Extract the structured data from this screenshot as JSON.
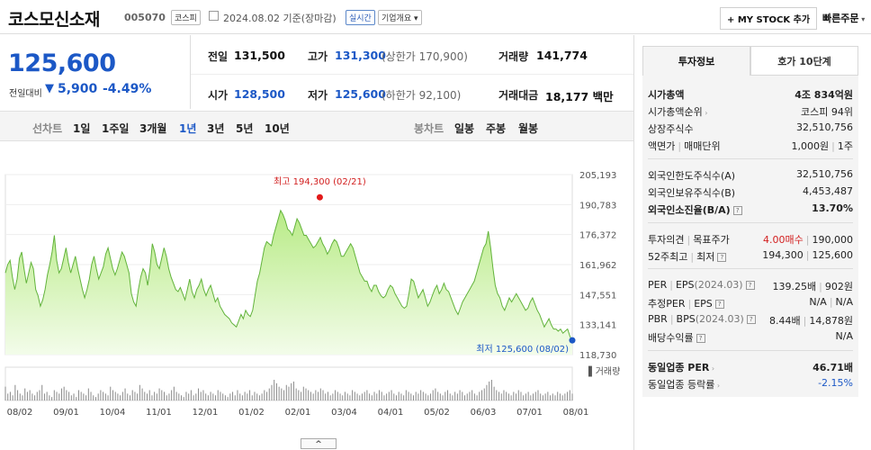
{
  "header": {
    "name": "코스모신소재",
    "code": "005070",
    "market_badge": "코스피",
    "date_text": "2024.08.02 기준(장마감)",
    "realtime_badge": "실시간",
    "company_btn": "기업개요",
    "mystock_btn": "+ MY STOCK 추가",
    "quick_order": "빠른주문"
  },
  "price": {
    "current": "125,600",
    "change_label": "전일대비",
    "change_arrow": "▼",
    "change": "5,900",
    "change_pct": "-4.49%"
  },
  "summary": {
    "prev_label": "전일",
    "prev": "131,500",
    "high_label": "고가",
    "high": "131,300",
    "upper_limit": "(상한가 170,900)",
    "volume_label": "거래량",
    "volume": "141,774",
    "open_label": "시가",
    "open": "128,500",
    "low_label": "저가",
    "low": "125,600",
    "lower_limit": "(하한가 92,100)",
    "amount_label": "거래대금",
    "amount": "18,177 백만"
  },
  "nav": {
    "line_label": "선차트",
    "line_periods": [
      "1일",
      "1주일",
      "3개월",
      "1년",
      "3년",
      "5년",
      "10년"
    ],
    "active": "1년",
    "bar_label": "봉차트",
    "bar_periods": [
      "일봉",
      "주봉",
      "월봉"
    ]
  },
  "chart_data": {
    "type": "area",
    "x_start": "2023-08-02",
    "x_end": "2024-08-02",
    "xticks": [
      "08/02",
      "09/01",
      "10/04",
      "11/01",
      "12/01",
      "01/02",
      "02/01",
      "03/04",
      "04/01",
      "05/02",
      "06/03",
      "07/01",
      "08/01"
    ],
    "yticks": [
      "205,193",
      "190,783",
      "176,372",
      "161,962",
      "147,551",
      "133,141",
      "118,730"
    ],
    "ylim": [
      118730,
      205193
    ],
    "high_annotation": "최고 194,300 (02/21)",
    "high_value": 194300,
    "high_date": "2024-02-21",
    "low_annotation": "최저 125,600 (08/02)",
    "low_value": 125600,
    "low_date": "2024-08-02",
    "values": [
      158000,
      162000,
      164000,
      156000,
      150000,
      155000,
      165000,
      168000,
      160000,
      153000,
      158000,
      163000,
      160000,
      150000,
      147000,
      142000,
      145000,
      150000,
      157000,
      162000,
      168000,
      176000,
      164000,
      158000,
      160000,
      165000,
      170000,
      163000,
      158000,
      162000,
      166000,
      160000,
      155000,
      150000,
      146000,
      150000,
      155000,
      162000,
      166000,
      160000,
      155000,
      158000,
      161000,
      167000,
      170000,
      165000,
      160000,
      157000,
      160000,
      164000,
      168000,
      166000,
      162000,
      158000,
      148000,
      144000,
      142000,
      150000,
      156000,
      160000,
      158000,
      152000,
      160000,
      172000,
      168000,
      162000,
      160000,
      165000,
      170000,
      166000,
      160000,
      156000,
      153000,
      150000,
      149000,
      151000,
      148000,
      145000,
      150000,
      155000,
      149000,
      146000,
      150000,
      152000,
      155000,
      150000,
      147000,
      150000,
      152000,
      148000,
      144000,
      146000,
      142000,
      140000,
      138000,
      137000,
      136000,
      134000,
      133000,
      132000,
      135000,
      138000,
      136000,
      140000,
      138000,
      137000,
      140000,
      147000,
      154000,
      158000,
      164000,
      170000,
      173000,
      172000,
      171000,
      176000,
      180000,
      184000,
      188000,
      186000,
      183000,
      179000,
      178000,
      176000,
      180000,
      184000,
      182000,
      179000,
      176000,
      176000,
      174000,
      172000,
      170000,
      171000,
      173000,
      175000,
      172000,
      170000,
      167000,
      169000,
      172000,
      174000,
      173000,
      170000,
      166000,
      166000,
      168000,
      170000,
      172000,
      170000,
      166000,
      162000,
      158000,
      156000,
      154000,
      154000,
      151000,
      149000,
      152000,
      152000,
      149000,
      147000,
      146000,
      147000,
      150000,
      152000,
      151000,
      148000,
      146000,
      144000,
      142000,
      141000,
      142000,
      148000,
      155000,
      154000,
      150000,
      146000,
      148000,
      150000,
      146000,
      142000,
      144000,
      147000,
      150000,
      152000,
      148000,
      150000,
      153000,
      150000,
      149000,
      146000,
      143000,
      140000,
      138000,
      141000,
      144000,
      146000,
      148000,
      150000,
      152000,
      154000,
      158000,
      162000,
      166000,
      170000,
      172000,
      178000,
      170000,
      160000,
      152000,
      148000,
      146000,
      142000,
      140000,
      143000,
      146000,
      144000,
      146000,
      148000,
      146000,
      144000,
      142000,
      140000,
      141000,
      144000,
      146000,
      143000,
      140000,
      138000,
      135000,
      132000,
      134000,
      136000,
      133000,
      131000,
      131000,
      130000,
      131000,
      129000,
      130000,
      131000,
      127500,
      125600
    ],
    "volume_label": "거래량",
    "volume_values": [
      8,
      4,
      5,
      3,
      9,
      6,
      4,
      3,
      7,
      5,
      6,
      4,
      3,
      5,
      6,
      9,
      4,
      5,
      3,
      2,
      6,
      5,
      4,
      7,
      8,
      6,
      5,
      3,
      4,
      2,
      6,
      5,
      4,
      3,
      7,
      5,
      3,
      2,
      4,
      6,
      5,
      4,
      3,
      8,
      6,
      5,
      4,
      3,
      5,
      7,
      4,
      3,
      6,
      5,
      4,
      9,
      7,
      5,
      4,
      6,
      3,
      5,
      4,
      7,
      6,
      5,
      3,
      4,
      6,
      8,
      5,
      4,
      3,
      2,
      5,
      4,
      6,
      3,
      4,
      7,
      5,
      6,
      4,
      3,
      5,
      4,
      3,
      6,
      5,
      4,
      3,
      2,
      4,
      5,
      3,
      6,
      4,
      3,
      5,
      4,
      6,
      3,
      5,
      4,
      3,
      4,
      6,
      5,
      7,
      9,
      12,
      10,
      8,
      7,
      6,
      9,
      8,
      10,
      11,
      7,
      6,
      5,
      8,
      7,
      6,
      5,
      4,
      6,
      5,
      7,
      6,
      4,
      5,
      3,
      4,
      6,
      5,
      4,
      3,
      5,
      4,
      3,
      6,
      5,
      4,
      3,
      4,
      5,
      6,
      4,
      3,
      5,
      4,
      6,
      5,
      3,
      4,
      5,
      6,
      4,
      3,
      5,
      4,
      3,
      6,
      5,
      4,
      3,
      5,
      4,
      6,
      5,
      4,
      3,
      4,
      6,
      7,
      5,
      4,
      3,
      5,
      6,
      4,
      3,
      5,
      4,
      6,
      5,
      3,
      4,
      5,
      6,
      4,
      3,
      5,
      6,
      7,
      9,
      11,
      12,
      8,
      6,
      5,
      4,
      6,
      5,
      4,
      3,
      5,
      4,
      6,
      5,
      3,
      4,
      5,
      3,
      4,
      5,
      6,
      4,
      3,
      4,
      5,
      3,
      4,
      3,
      5,
      4,
      3,
      4,
      5,
      6,
      4
    ]
  },
  "right_panel": {
    "tabs": [
      "투자정보",
      "호가 10단계"
    ],
    "market_cap_label": "시가총액",
    "market_cap": "4조 834억원",
    "cap_rank_label": "시가총액순위",
    "cap_rank": "코스피 94위",
    "shares_label": "상장주식수",
    "shares": "32,510,756",
    "par_label": "액면가",
    "par_sep": "매매단위",
    "par": "1,000원",
    "par_unit": "1주",
    "foreign_limit_label": "외국인한도주식수(A)",
    "foreign_limit": "32,510,756",
    "foreign_hold_label": "외국인보유주식수(B)",
    "foreign_hold": "4,453,487",
    "foreign_ratio_label": "외국인소진율(B/A)",
    "foreign_ratio": "13.70%",
    "opinion_label": "투자의견",
    "target_label": "목표주가",
    "opinion": "4.00매수",
    "target": "190,000",
    "w52_label": "52주최고",
    "w52_low_label": "최저",
    "w52_high": "194,300",
    "w52_low": "125,600",
    "per_label": "PER",
    "eps_label": "EPS",
    "eps_period": "(2024.03)",
    "per": "139.25배",
    "eps": "902원",
    "est_per_label": "추정PER",
    "est_eps_label": "EPS",
    "est_per": "N/A",
    "est_eps": "N/A",
    "pbr_label": "PBR",
    "bps_label": "BPS",
    "bps_period": "(2024.03)",
    "pbr": "8.44배",
    "bps": "14,878원",
    "div_label": "배당수익률",
    "div": "N/A",
    "ind_per_label": "동일업종 PER",
    "ind_per": "46.71배",
    "ind_chg_label": "동일업종 등락률",
    "ind_chg": "-2.15%"
  },
  "footer": {
    "expand_icon": "^"
  }
}
